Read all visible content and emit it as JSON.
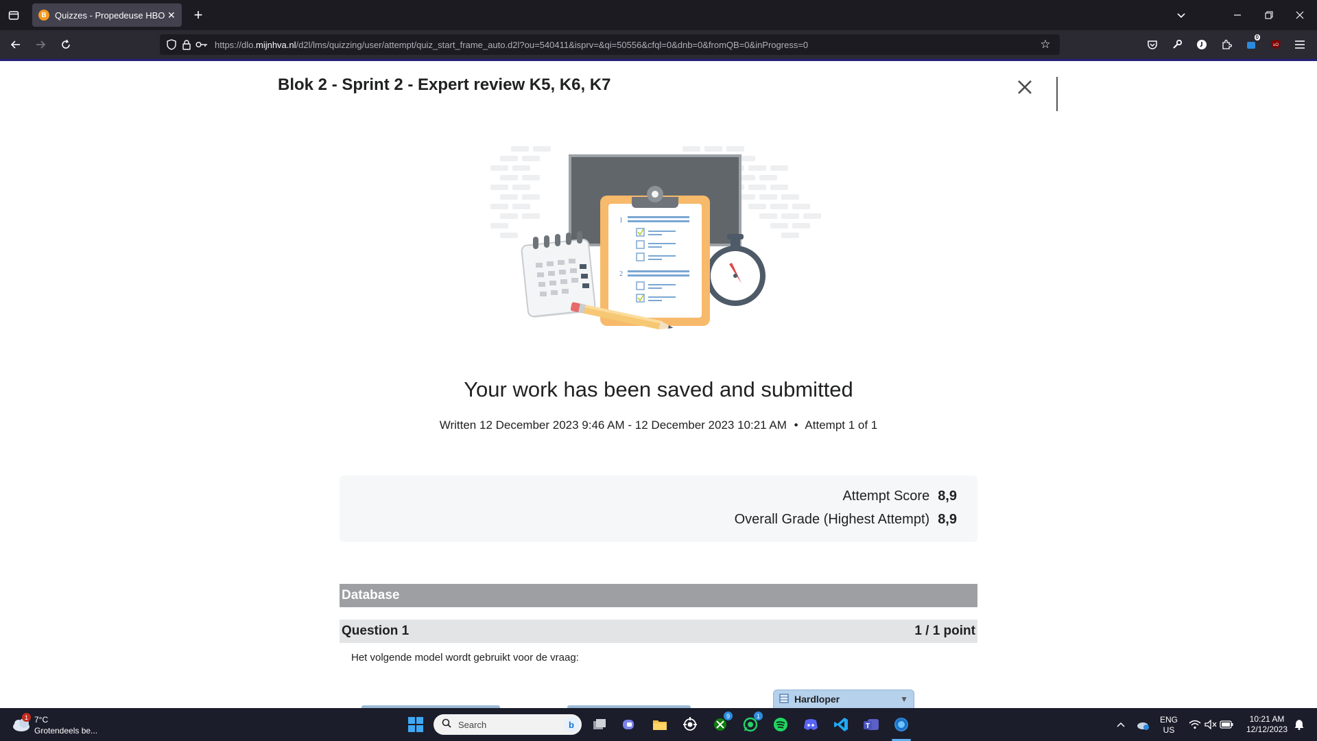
{
  "browser": {
    "tab_title": "Quizzes - Propedeuse HBO-ICT",
    "tab_favicon_letter": "B",
    "url_prefix": "https://dlo.",
    "url_domain": "mijnhva.nl",
    "url_path": "/d2l/lms/quizzing/user/attempt/quiz_start_frame_auto.d2l?ou=540411&isprv=&qi=50556&cfql=0&dnb=0&fromQB=0&inProgress=0",
    "new_tab_label": "+",
    "badge_count": "0"
  },
  "page": {
    "quiz_title": "Blok 2 - Sprint 2 - Expert review K5, K6, K7",
    "heading": "Your work has been saved and submitted",
    "written_info": "Written 12 December 2023 9:46 AM - 12 December 2023 10:21 AM",
    "attempt_info": "Attempt 1 of 1",
    "scores": {
      "attempt_label": "Attempt Score",
      "attempt_value": "8,9",
      "overall_label": "Overall Grade (Highest Attempt)",
      "overall_value": "8,9"
    },
    "section_title": "Database",
    "question_title": "Question 1",
    "question_points": "1 / 1 point",
    "question_text": "Het volgende model wordt gebruikt voor de vraag:",
    "entity_label": "Hardloper"
  },
  "illustration": {
    "checklist_numbers": [
      "1",
      "2"
    ]
  },
  "taskbar": {
    "weather_temp": "7°C",
    "weather_desc": "Grotendeels be...",
    "weather_badge": "1",
    "search_placeholder": "Search",
    "xbox_badge": "9",
    "whatsapp_badge": "1",
    "lang_top": "ENG",
    "lang_bottom": "US",
    "time": "10:21 AM",
    "date": "12/12/2023"
  },
  "colors": {
    "accent_bar": "#25207a",
    "section_bar": "#9d9fa2",
    "question_bar": "#e3e4e5"
  }
}
